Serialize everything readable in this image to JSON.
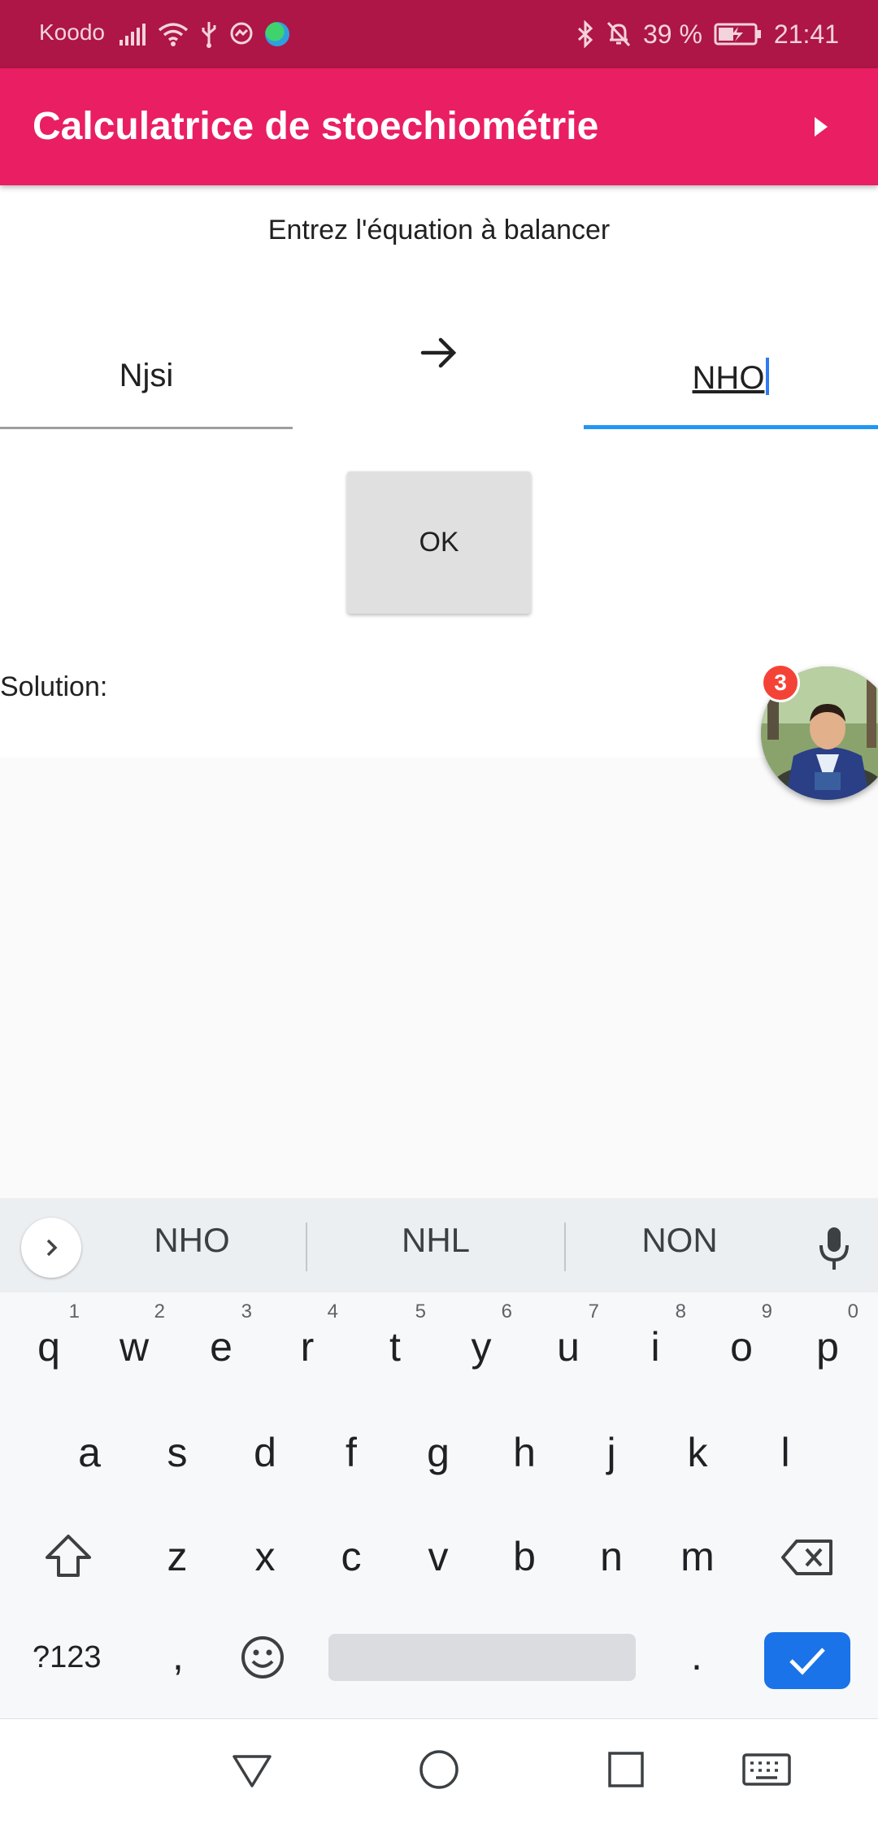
{
  "status_bar": {
    "carrier": "Koodo",
    "battery": "39 %",
    "time": "21:41",
    "icons": [
      "signal-icon",
      "wifi-icon",
      "usb-icon",
      "messenger-icon",
      "globe-icon",
      "bluetooth-icon",
      "bell-off-icon",
      "battery-charging-icon"
    ]
  },
  "app_bar": {
    "title": "Calculatrice de stoechiométrie",
    "action_icon": "play-arrow-icon",
    "color": "#e91e63"
  },
  "equation": {
    "prompt": "Entrez l'équation à balancer",
    "reactants_value": "Njsi",
    "products_value": "NHO",
    "arrow_icon": "arrow-right-icon"
  },
  "ok_button": {
    "label": "OK"
  },
  "solution": {
    "label": "Solution:"
  },
  "chat_head": {
    "badge_count": "3"
  },
  "keyboard": {
    "suggestions": [
      "NHO",
      "NHL",
      "NON"
    ],
    "row1": [
      {
        "k": "q",
        "n": "1"
      },
      {
        "k": "w",
        "n": "2"
      },
      {
        "k": "e",
        "n": "3"
      },
      {
        "k": "r",
        "n": "4"
      },
      {
        "k": "t",
        "n": "5"
      },
      {
        "k": "y",
        "n": "6"
      },
      {
        "k": "u",
        "n": "7"
      },
      {
        "k": "i",
        "n": "8"
      },
      {
        "k": "o",
        "n": "9"
      },
      {
        "k": "p",
        "n": "0"
      }
    ],
    "row2": [
      "a",
      "s",
      "d",
      "f",
      "g",
      "h",
      "j",
      "k",
      "l"
    ],
    "row3": [
      "z",
      "x",
      "c",
      "v",
      "b",
      "n",
      "m"
    ],
    "symbols_label": "?123",
    "comma": ",",
    "period": ".",
    "accent_color": "#1a73e8"
  },
  "nav_bar": {
    "icons": [
      "back-icon",
      "home-icon",
      "recents-icon",
      "keyboard-icon"
    ]
  }
}
